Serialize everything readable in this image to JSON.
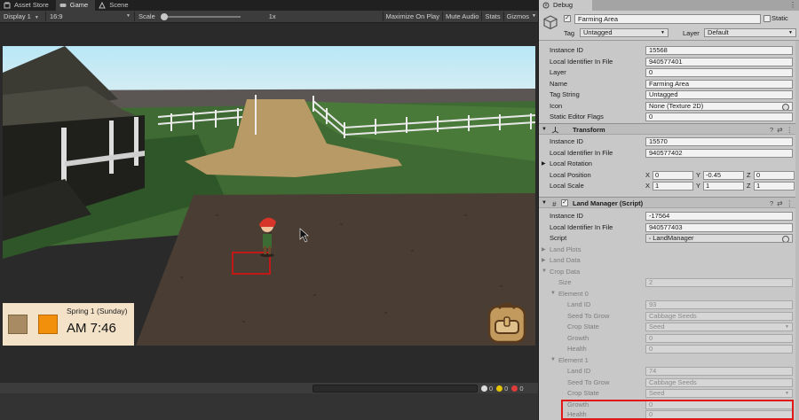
{
  "game_view": {
    "tabs": [
      {
        "label": "Asset Store"
      },
      {
        "label": "Game"
      },
      {
        "label": "Scene"
      }
    ],
    "display_dropdown": "Display 1",
    "aspect_dropdown": "16:9",
    "scale_label": "Scale",
    "scale_value": "1x",
    "buttons": {
      "maximize": "Maximize On Play",
      "mute": "Mute Audio",
      "stats": "Stats",
      "gizmos": "Gizmos"
    },
    "hud": {
      "date": "Spring 1 (Sunday)",
      "time": "AM 7:46",
      "slot_colors": [
        "#a88b62",
        "#f2900b"
      ]
    },
    "console_counts": {
      "log": "0",
      "warning": "0",
      "error": "0"
    }
  },
  "inspector": {
    "tab_label": "Debug",
    "object_name": "Farming Area",
    "static_label": "Static",
    "tag_label": "Tag",
    "tag_value": "Untagged",
    "layer_label": "Layer",
    "layer_value": "Default",
    "object_fields": [
      {
        "label": "Instance ID",
        "value": "15568"
      },
      {
        "label": "Local Identifier In File",
        "value": "940577401"
      },
      {
        "label": "Layer",
        "value": "0"
      },
      {
        "label": "Name",
        "value": "Farming Area"
      },
      {
        "label": "Tag String",
        "value": "Untagged"
      },
      {
        "label": "Icon",
        "value": "None (Texture 2D)"
      },
      {
        "label": "Static Editor Flags",
        "value": "0"
      }
    ],
    "transform": {
      "title": "Transform",
      "instance_id_label": "Instance ID",
      "instance_id": "15570",
      "local_identifier_label": "Local Identifier In File",
      "local_identifier": "940577402",
      "local_rotation_label": "Local Rotation",
      "local_position_label": "Local Position",
      "position": {
        "x": "0",
        "y": "-0.45",
        "z": "0"
      },
      "local_scale_label": "Local Scale",
      "scale": {
        "x": "1",
        "y": "1",
        "z": "1"
      }
    },
    "land_manager": {
      "title": "Land Manager (Script)",
      "instance_id_label": "Instance ID",
      "instance_id": "-17564",
      "local_identifier_label": "Local Identifier In File",
      "local_identifier": "940577403",
      "script_label": "Script",
      "script_value": "LandManager",
      "land_plots_label": "Land Plots",
      "land_data_label": "Land Data",
      "crop_data_label": "Crop Data",
      "size_label": "Size",
      "size_value": "2",
      "elements": [
        {
          "header": "Element 0",
          "land_id_label": "Land ID",
          "land_id": "93",
          "seed_label": "Seed To Grow",
          "seed": "Cabbage Seeds",
          "state_label": "Crop State",
          "state": "Seed",
          "growth_label": "Growth",
          "growth": "0",
          "health_label": "Health",
          "health": "0"
        },
        {
          "header": "Element 1",
          "land_id_label": "Land ID",
          "land_id": "74",
          "seed_label": "Seed To Grow",
          "seed": "Cabbage Seeds",
          "state_label": "Crop State",
          "state": "Seed",
          "growth_label": "Growth",
          "growth": "0",
          "health_label": "Health",
          "health": "0"
        }
      ]
    }
  },
  "colors": {
    "editor_dark": "#383838",
    "inspector_bg": "#c8c8c8",
    "highlight_red": "#e01818",
    "grass": "#3f6a33",
    "soil": "#4a3d33"
  },
  "icons": [
    "store-icon",
    "game-icon",
    "scene-icon",
    "debug-icon",
    "gameobject-cube-icon",
    "transform-icon",
    "script-icon",
    "help-icon",
    "preset-icon",
    "more-icon",
    "backpack-icon",
    "cursor-icon"
  ]
}
